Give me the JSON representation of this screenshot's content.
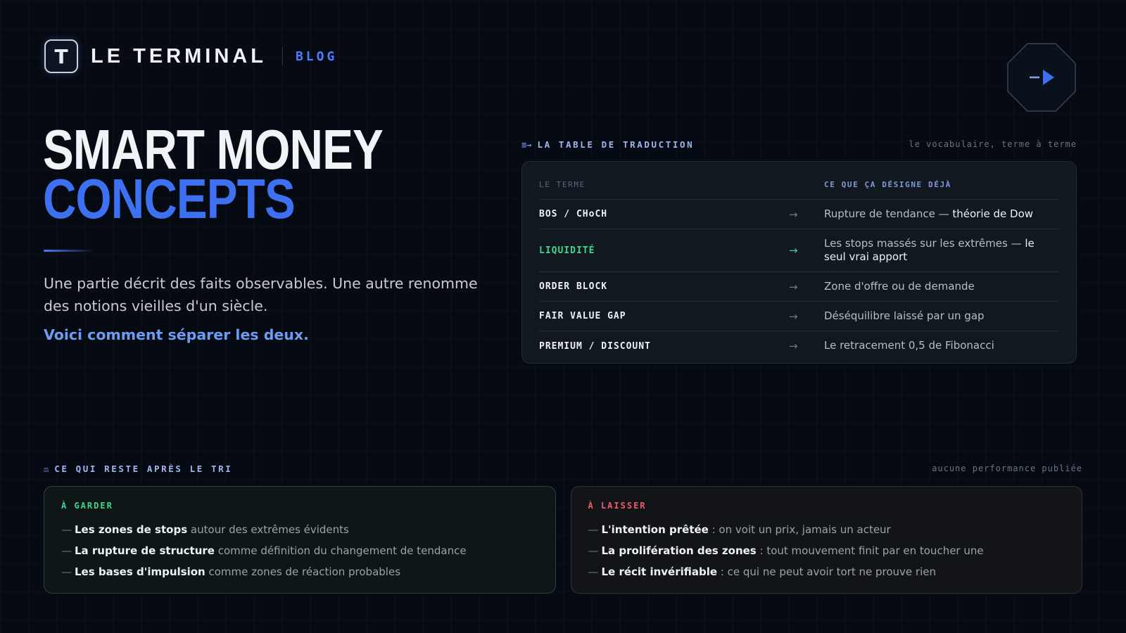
{
  "header": {
    "logo_letter": "T",
    "title": "LE TERMINAL",
    "section": "BLOG"
  },
  "hero": {
    "title_line1": "SMART MONEY",
    "title_line2": "CONCEPTS",
    "lead": "Une partie décrit des faits observables. Une autre renomme des notions vieilles d'un siècle.",
    "cta": "Voici comment séparer les deux."
  },
  "translation_table": {
    "heading": "LA TABLE DE TRADUCTION",
    "note": "le vocabulaire, terme à terme",
    "col_term": "LE TERME",
    "col_meaning": "CE QUE ÇA DÉSIGNE DÉJÀ",
    "arrow": "→",
    "rows": [
      {
        "term": "BOS / CHoCH",
        "desc": "Rupture de tendance — ",
        "desc_strong": "théorie de Dow"
      },
      {
        "term": "LIQUIDITÉ",
        "desc": "Les stops massés sur les extrêmes — ",
        "desc_strong": "le seul vrai apport"
      },
      {
        "term": "ORDER BLOCK",
        "desc": "Zone d'offre ou de demande",
        "desc_strong": ""
      },
      {
        "term": "FAIR VALUE GAP",
        "desc": "Déséquilibre laissé par un gap",
        "desc_strong": ""
      },
      {
        "term": "PREMIUM / DISCOUNT",
        "desc": "Le retracement 0,5 de Fibonacci",
        "desc_strong": ""
      }
    ]
  },
  "sorting": {
    "heading": "CE QUI RESTE APRÈS LE TRI",
    "note": "aucune performance publiée",
    "keep": {
      "title": "À GARDER",
      "items": [
        {
          "strong": "Les zones de stops",
          "rest": " autour des extrêmes évidents"
        },
        {
          "strong": "La rupture de structure",
          "rest": " comme définition du changement de tendance"
        },
        {
          "strong": "Les bases d'impulsion",
          "rest": " comme zones de réaction probables"
        }
      ]
    },
    "drop": {
      "title": "À LAISSER",
      "items": [
        {
          "strong": "L'intention prêtée",
          "rest": " : on voit un prix, jamais un acteur"
        },
        {
          "strong": "La prolifération des zones",
          "rest": " : tout mouvement finit par en toucher une"
        },
        {
          "strong": "Le récit invérifiable",
          "rest": " : ce qui ne peut avoir tort ne prouve rien"
        }
      ]
    }
  },
  "colors": {
    "accent": "#3e70f2",
    "keep": "#3dd68c",
    "drop": "#f05a6a"
  },
  "icons": {
    "next": "play-arrow-icon",
    "table_heading": "list-arrow-icon",
    "sort_heading": "scale-icon"
  }
}
